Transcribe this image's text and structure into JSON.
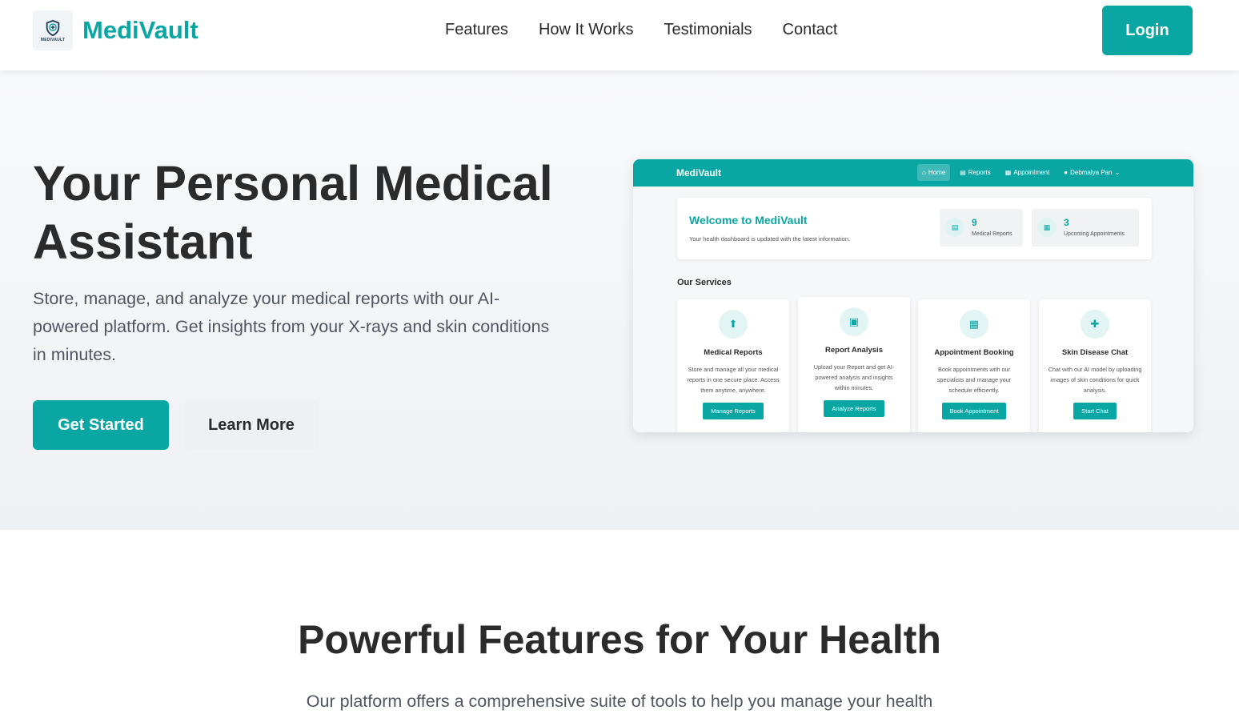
{
  "nav": {
    "brand": "MediVault",
    "logo_text": "MEDIVAULT",
    "links": [
      "Features",
      "How It Works",
      "Testimonials",
      "Contact"
    ],
    "login": "Login"
  },
  "hero": {
    "title": "Your Personal Medical Assistant",
    "subtitle": "Store, manage, and analyze your medical reports with our AI-powered platform. Get insights from your X-rays and skin conditions in minutes.",
    "primary_button": "Get Started",
    "secondary_button": "Learn More"
  },
  "mockup": {
    "brand": "MediVault",
    "nav": [
      {
        "icon": "home-icon",
        "label": "Home"
      },
      {
        "icon": "file-icon",
        "label": "Reports"
      },
      {
        "icon": "calendar-icon",
        "label": "Appointment"
      },
      {
        "icon": "user-icon",
        "label": "Debmalya Pan"
      }
    ],
    "welcome_title": "Welcome to MediVault",
    "welcome_sub": "Your health dashboard is updated with the latest information.",
    "stats": [
      {
        "value": "9",
        "label": "Medical Reports"
      },
      {
        "value": "3",
        "label": "Upcoming Appointments"
      }
    ],
    "services_title": "Our Services",
    "services": [
      {
        "icon": "upload-file-icon",
        "title": "Medical Reports",
        "desc": "Store and manage all your medical reports in one secure place. Access them anytime, anywhere.",
        "button": "Manage Reports"
      },
      {
        "icon": "analysis-icon",
        "title": "Report Analysis",
        "desc": "Upload your Report and get AI-powered analysis and insights within minutes.",
        "button": "Analyze Reports"
      },
      {
        "icon": "calendar-icon",
        "title": "Appointment Booking",
        "desc": "Book appointments with our specialists and manage your schedule efficiently.",
        "button": "Book Appointment"
      },
      {
        "icon": "chat-icon",
        "title": "Skin Disease Chat",
        "desc": "Chat with our AI model by uploading images of skin conditions for quick analysis.",
        "button": "Start Chat"
      }
    ]
  },
  "features": {
    "title": "Powerful Features for Your Health",
    "subtitle": "Our platform offers a comprehensive suite of tools to help you manage your health"
  },
  "colors": {
    "accent": "#0aa6a3",
    "text": "#2b2b2b",
    "muted": "#505660"
  }
}
